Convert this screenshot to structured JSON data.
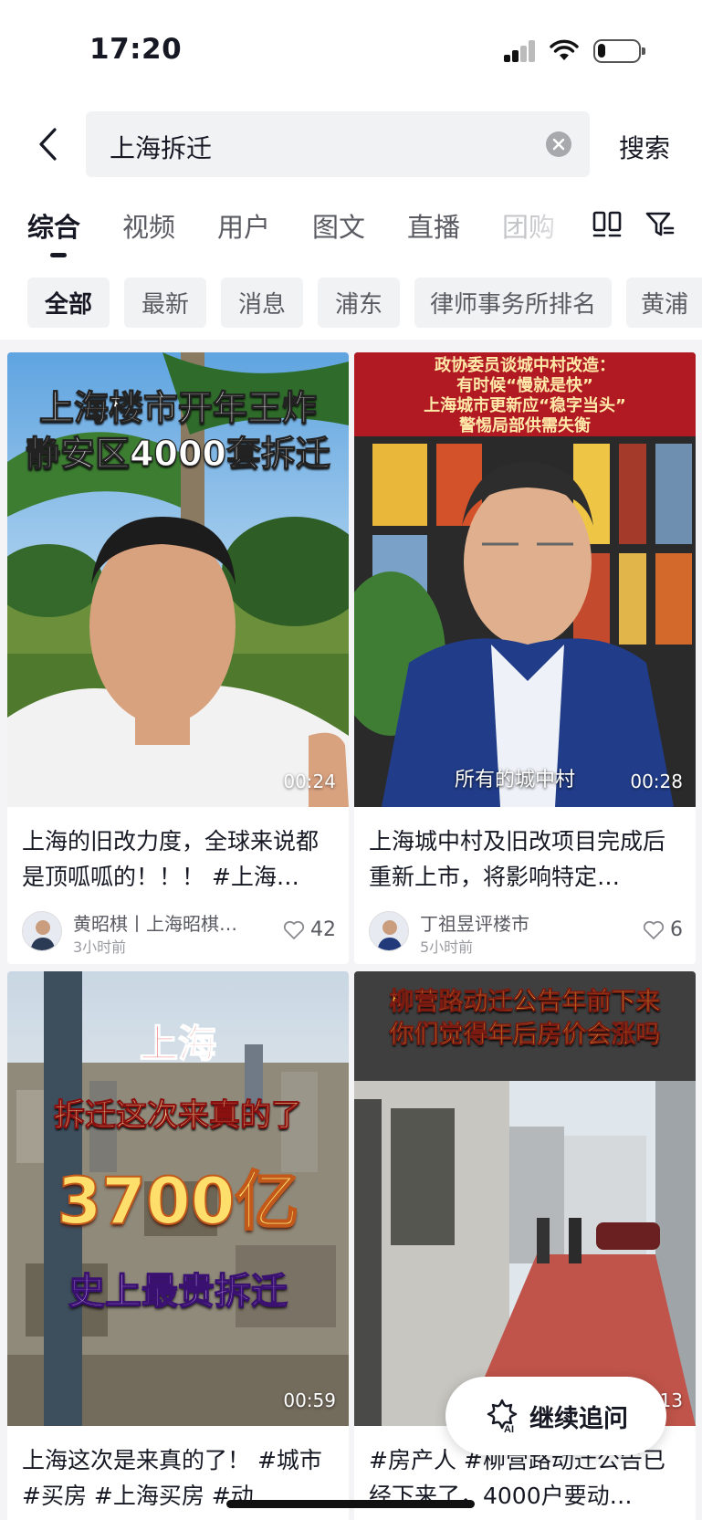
{
  "status": {
    "time": "17:20",
    "battery_level": 0.2
  },
  "search": {
    "query": "上海拆迁",
    "submit_label": "搜索"
  },
  "tabs": [
    {
      "label": "综合",
      "active": true
    },
    {
      "label": "视频"
    },
    {
      "label": "用户"
    },
    {
      "label": "图文"
    },
    {
      "label": "直播"
    },
    {
      "label": "团购"
    }
  ],
  "chips": [
    {
      "label": "全部",
      "active": true
    },
    {
      "label": "最新"
    },
    {
      "label": "消息"
    },
    {
      "label": "浦东"
    },
    {
      "label": "律师事务所排名"
    },
    {
      "label": "黄浦"
    }
  ],
  "results": [
    {
      "overlay": [
        "上海楼市开年王炸",
        "静安区4000套拆迁"
      ],
      "duration": "00:24",
      "title": "上海的旧改力度，全球来说都是顶呱呱的！！！ #上海…",
      "author": "黄昭棋丨上海昭棋…",
      "time": "3小时前",
      "likes": "42"
    },
    {
      "overlay": [
        "政协委员谈城中村改造：",
        "有时候“慢就是快”",
        "上海城市更新应“稳字当头”",
        "警惕局部供需失衡"
      ],
      "caption": "所有的城中村",
      "duration": "00:28",
      "title": "上海城中村及旧改项目完成后重新上市，将影响特定…",
      "author": "丁祖昱评楼市",
      "time": "5小时前",
      "likes": "6"
    },
    {
      "overlay": [
        "上海",
        "拆迁这次来真的了",
        "3700亿",
        "史上最贵拆迁"
      ],
      "duration": "00:59",
      "title": "上海这次是来真的了！ #城市 #买房 #上海买房 #动…"
    },
    {
      "overlay": [
        "柳营路动迁公告年前下来",
        "你们觉得年后房价会涨吗"
      ],
      "duration": "00:13",
      "title": "#房产人 #柳营路动迁公告已经下来了，4000户要动…"
    }
  ],
  "floating_button": {
    "label": "继续追问",
    "icon_text": "AI"
  }
}
